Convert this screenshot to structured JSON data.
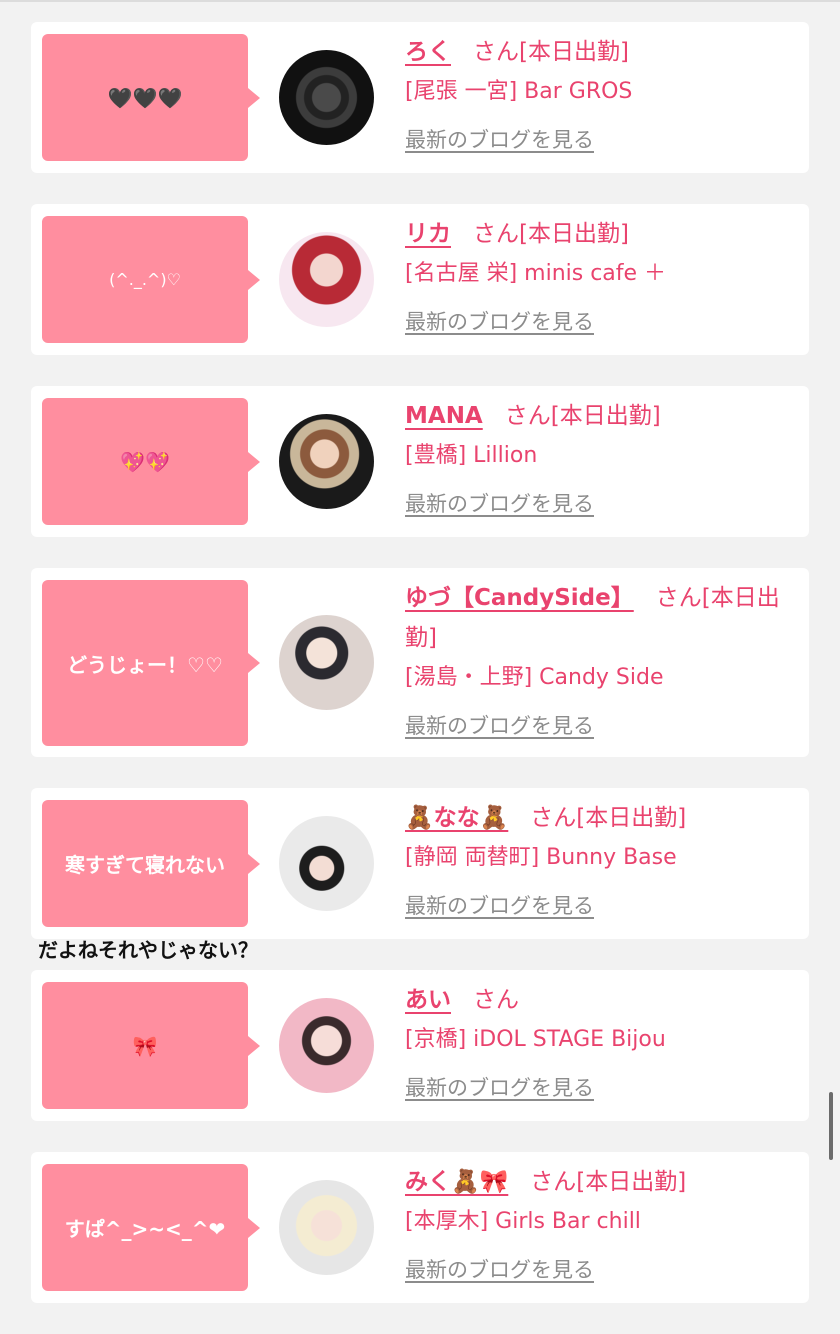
{
  "entries": [
    {
      "bubble": "🖤🖤🖤",
      "name": "ろく",
      "suffix": "さん[本日出勤]",
      "shop": "[尾張 一宮] Bar GROS",
      "blog": "最新のブログを見る"
    },
    {
      "bubble": "(^._.^)♡",
      "name": "リカ",
      "suffix": "さん[本日出勤]",
      "shop": "[名古屋 栄] minis cafe ＋",
      "blog": "最新のブログを見る"
    },
    {
      "bubble": "💖💖",
      "name": "MANA",
      "suffix": "さん[本日出勤]",
      "shop": "[豊橋] Lillion",
      "blog": "最新のブログを見る"
    },
    {
      "bubble": "どうじょー！♡♡",
      "name": "ゆづ【CandySide】",
      "suffix": "さん[本日出勤]",
      "shop": "[湯島・上野] Candy Side",
      "blog": "最新のブログを見る"
    },
    {
      "bubble": "寒すぎて寝れない",
      "name": "🧸なな🧸",
      "suffix": "さん[本日出勤]",
      "shop": "[静岡 両替町] Bunny Base",
      "blog": "最新のブログを見る"
    },
    {
      "bubble": "🎀",
      "name": "あい",
      "suffix": "さん",
      "shop": "[京橋] iDOL STAGE Bijou",
      "blog": "最新のブログを見る"
    },
    {
      "bubble": "すぱ^_>~<_^❤",
      "name": "みく🧸🎀",
      "suffix": "さん[本日出勤]",
      "shop": "[本厚木] Girls Bar chill",
      "blog": "最新のブログを見る"
    }
  ],
  "overlay_note": "だよねそれやじゃない？"
}
